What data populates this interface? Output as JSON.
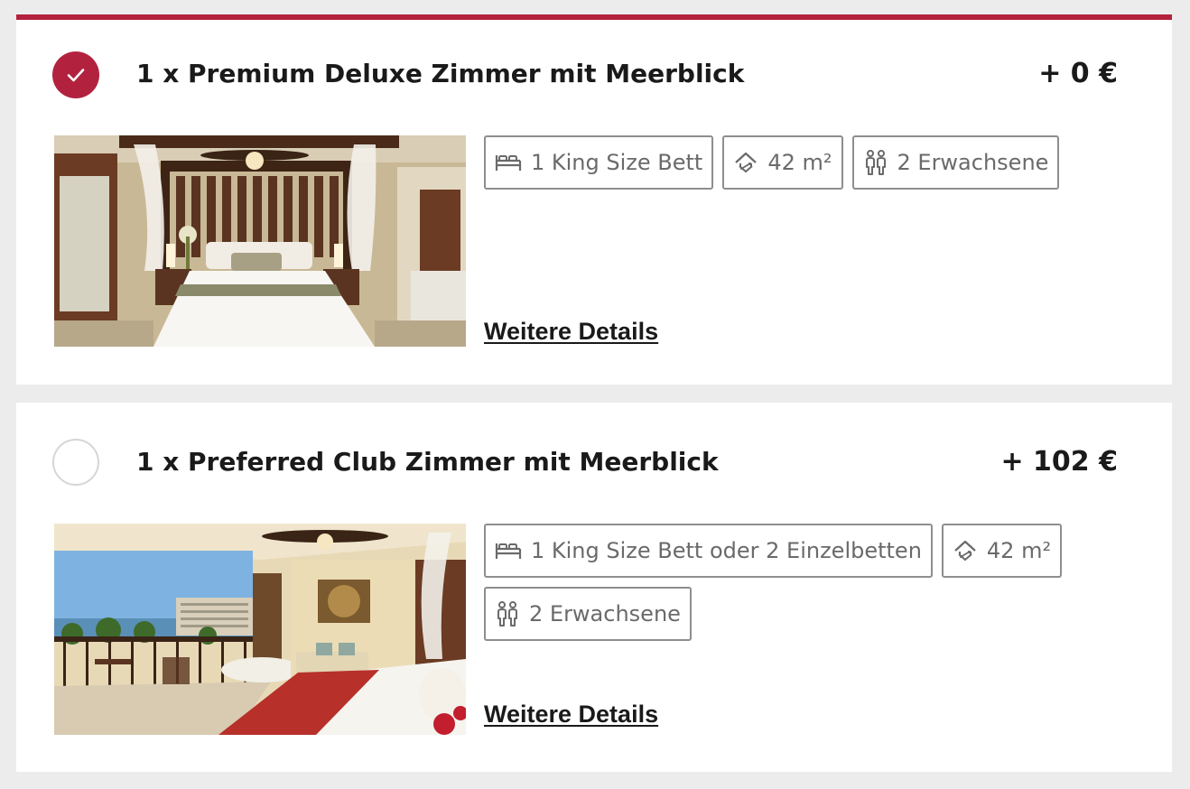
{
  "colors": {
    "accent": "#b2223f",
    "background": "#ececec",
    "card": "#ffffff",
    "border": "#8e8e8e"
  },
  "rooms": [
    {
      "selected": true,
      "title": "1 x Premium Deluxe Zimmer mit Meerblick",
      "price": "+ 0 €",
      "features": [
        {
          "icon": "bed-icon",
          "label": "1 King Size Bett"
        },
        {
          "icon": "room-size-icon",
          "label": "42 m²"
        },
        {
          "icon": "adults-icon",
          "label": "2 Erwachsene"
        }
      ],
      "details_label": "Weitere Details"
    },
    {
      "selected": false,
      "title": "1 x Preferred Club Zimmer mit Meerblick",
      "price": "+ 102 €",
      "features": [
        {
          "icon": "bed-icon",
          "label": "1 King Size Bett oder 2 Einzelbetten"
        },
        {
          "icon": "room-size-icon",
          "label": "42 m²"
        },
        {
          "icon": "adults-icon",
          "label": "2 Erwachsene"
        }
      ],
      "details_label": "Weitere Details"
    }
  ]
}
